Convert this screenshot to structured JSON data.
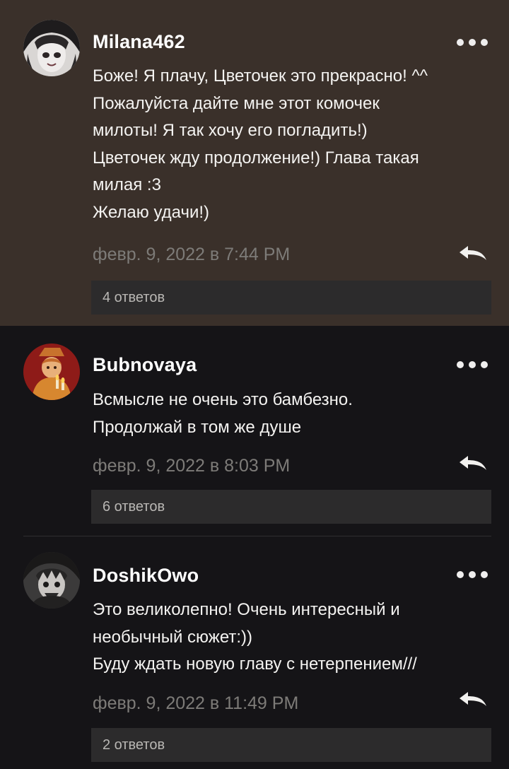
{
  "colors": {
    "background": "#151417",
    "highlight_background": "#3a302a",
    "username": "#ffffff",
    "body_text": "#f4f3f1",
    "timestamp": "#7d7b78",
    "replies_button_bg": "#2c2b2c",
    "replies_button_text": "#b9b7b4"
  },
  "comments": [
    {
      "username": "Milana462",
      "avatar_icon": "anime-girl-avatar",
      "highlighted": true,
      "lines": [
        "Боже! Я плачу, Цветочек это прекрасно! ^^",
        "Пожалуйста дайте мне этот комочек",
        "милоты! Я так хочу его погладить!)",
        "Цветочек жду продолжение!) Глава такая",
        "милая :3",
        "Желаю удачи!)"
      ],
      "timestamp": "февр. 9, 2022 в 7:44 PM",
      "replies_label": "4 ответов"
    },
    {
      "username": "Bubnovaya",
      "avatar_icon": "character-with-candles-avatar",
      "highlighted": false,
      "lines": [
        "Всмысле не очень это бамбезно.",
        "Продолжай в том же душе"
      ],
      "timestamp": "февр. 9, 2022 в 8:03 PM",
      "replies_label": "6 ответов"
    },
    {
      "username": "DoshikOwo",
      "avatar_icon": "manga-character-avatar",
      "highlighted": false,
      "lines": [
        "Это великолепно! Очень интересный и",
        "необычный сюжет:))",
        "Буду ждать новую главу с нетерпением///"
      ],
      "timestamp": "февр. 9, 2022 в 11:49 PM",
      "replies_label": "2 ответов"
    }
  ]
}
